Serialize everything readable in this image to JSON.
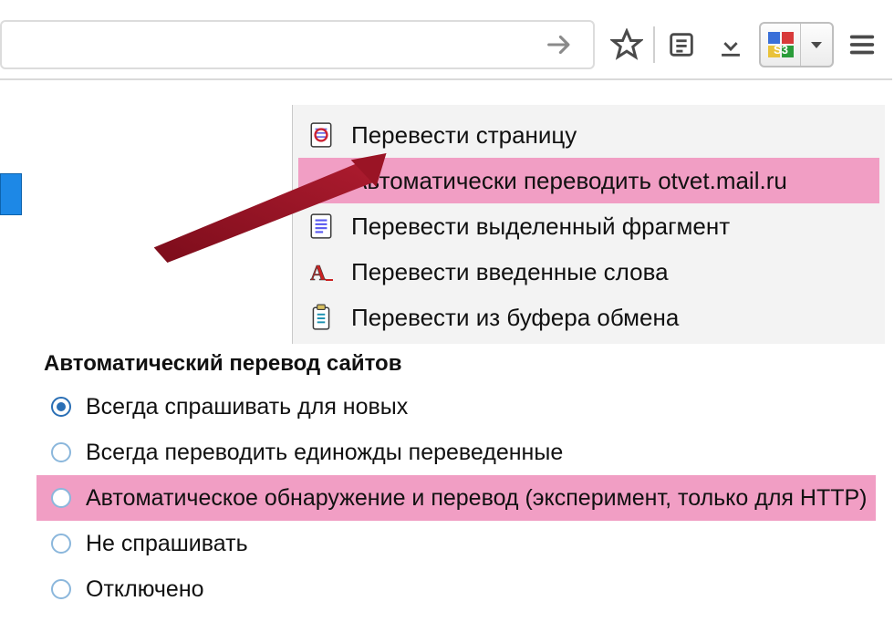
{
  "toolbar": {
    "go_tooltip": "Go",
    "star_tooltip": "Bookmark",
    "list_tooltip": "Reading list",
    "download_tooltip": "Downloads",
    "s3_label": "S3",
    "menu_tooltip": "Menu"
  },
  "context_menu": {
    "items": [
      {
        "label": "Перевести страницу",
        "icon": "page-swirl",
        "highlight": false
      },
      {
        "label": "Автоматически переводить otvet.mail.ru",
        "icon": "",
        "highlight": true
      },
      {
        "label": "Перевести выделенный фрагмент",
        "icon": "page-lines",
        "highlight": false
      },
      {
        "label": "Перевести введенные слова",
        "icon": "letter-a",
        "highlight": false
      },
      {
        "label": "Перевести из буфера обмена",
        "icon": "clipboard",
        "highlight": false
      }
    ]
  },
  "options": {
    "title": "Автоматический перевод сайтов",
    "items": [
      {
        "label": "Всегда спрашивать для новых",
        "checked": true,
        "highlight": false
      },
      {
        "label": "Всегда переводить единожды переведенные",
        "checked": false,
        "highlight": false
      },
      {
        "label": "Автоматическое обнаружение и перевод (эксперимент, только для HTTP)",
        "checked": false,
        "highlight": true
      },
      {
        "label": "Не спрашивать",
        "checked": false,
        "highlight": false
      },
      {
        "label": "Отключено",
        "checked": false,
        "highlight": false
      }
    ]
  }
}
